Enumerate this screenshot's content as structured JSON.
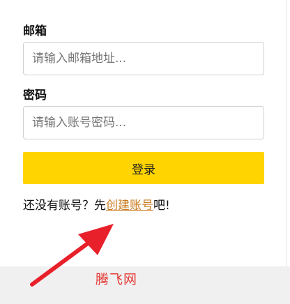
{
  "form": {
    "email_label": "邮箱",
    "email_placeholder": "请输入邮箱地址...",
    "password_label": "密码",
    "password_placeholder": "请输入账号密码...",
    "login_button": "登录",
    "signup_prefix": "还没有账号？先",
    "signup_link": "创建账号",
    "signup_suffix": "吧!"
  },
  "watermark": "腾飞网",
  "colors": {
    "button": "#ffd400",
    "link": "#c87a1e",
    "arrow": "#e8202a",
    "watermark": "#e53935"
  }
}
